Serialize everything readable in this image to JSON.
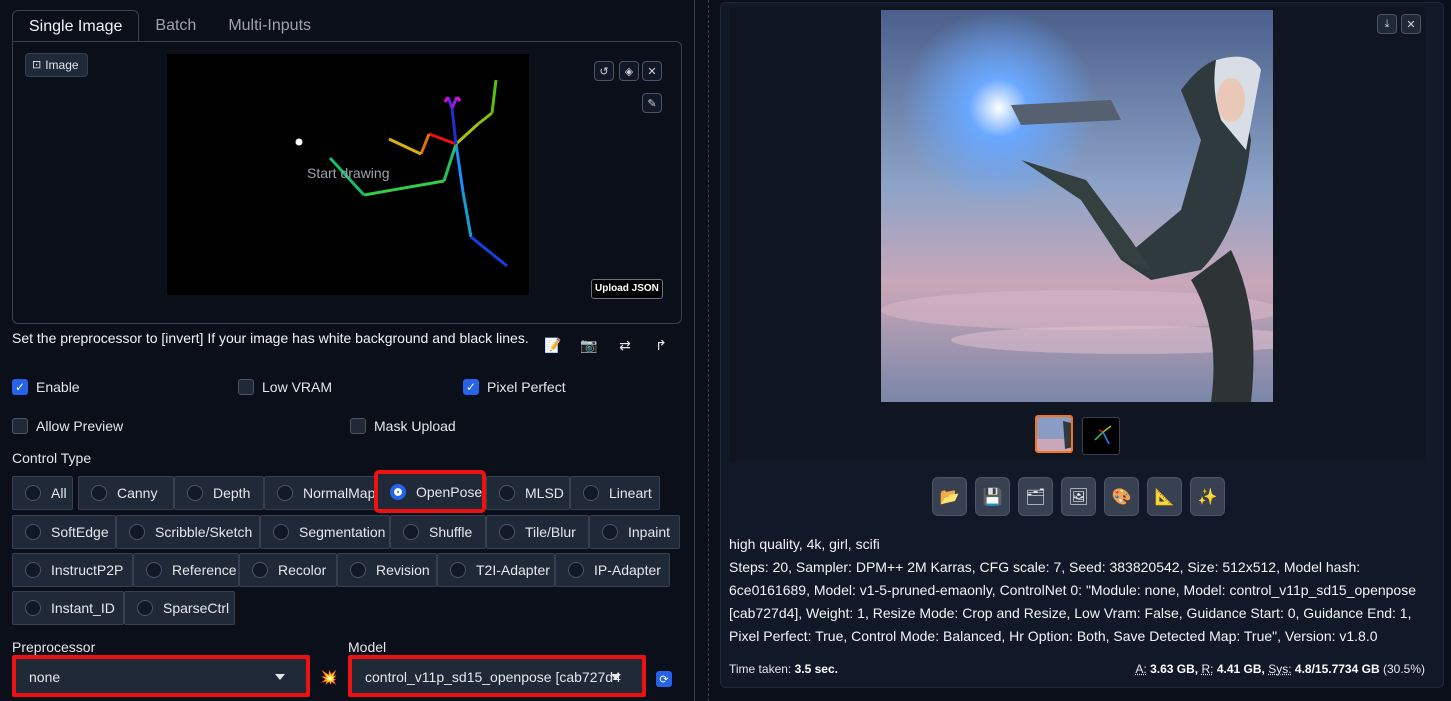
{
  "tabs": [
    "Single Image",
    "Batch",
    "Multi-Inputs"
  ],
  "image_label": "Image",
  "canvas": {
    "placeholder": "Start drawing",
    "upload_json": "Upload JSON"
  },
  "hint": "Set the preprocessor to [invert] If your image has white background and black lines.",
  "tool_icons": [
    "edit-icon",
    "camera-icon",
    "swap-icon",
    "redo-arrow-icon"
  ],
  "checkboxes": {
    "enable": {
      "label": "Enable",
      "checked": true
    },
    "low_vram": {
      "label": "Low VRAM",
      "checked": false
    },
    "pixel_perfect": {
      "label": "Pixel Perfect",
      "checked": true
    },
    "allow_preview": {
      "label": "Allow Preview",
      "checked": false
    },
    "mask_upload": {
      "label": "Mask Upload",
      "checked": false
    }
  },
  "control_type": {
    "label": "Control Type",
    "selected": "OpenPose",
    "options": [
      "All",
      "Canny",
      "Depth",
      "NormalMap",
      "OpenPose",
      "MLSD",
      "Lineart",
      "SoftEdge",
      "Scribble/Sketch",
      "Segmentation",
      "Shuffle",
      "Tile/Blur",
      "Inpaint",
      "InstructP2P",
      "Reference",
      "Recolor",
      "Revision",
      "T2I-Adapter",
      "IP-Adapter",
      "Instant_ID",
      "SparseCtrl"
    ]
  },
  "preprocessor": {
    "label": "Preprocessor",
    "value": "none"
  },
  "model": {
    "label": "Model",
    "value": "control_v11p_sd15_openpose [cab727d4"
  },
  "output": {
    "prompt": "high quality, 4k, girl, scifi",
    "params": "Steps: 20, Sampler: DPM++ 2M Karras, CFG scale: 7, Seed: 383820542, Size: 512x512, Model hash: 6ce0161689, Model: v1-5-pruned-emaonly, ControlNet 0: \"Module: none, Model: control_v11p_sd15_openpose [cab727d4], Weight: 1, Resize Mode: Crop and Resize, Low Vram: False, Guidance Start: 0, Guidance End: 1, Pixel Perfect: True, Control Mode: Balanced, Hr Option: Both, Save Detected Map: True\", Version: v1.8.0",
    "time_label": "Time taken:",
    "time_value": "3.5 sec.",
    "mem_a_label": "A:",
    "mem_a": "3.63 GB,",
    "mem_r_label": "R:",
    "mem_r": "4.41 GB,",
    "mem_sys_label": "Sys:",
    "mem_sys": "4.8/15.7734 GB",
    "mem_pct": "(30.5%)"
  },
  "action_buttons": [
    "folder-icon",
    "save-icon",
    "zip-icon",
    "image-icon",
    "palette-icon",
    "ruler-icon",
    "sparkle-icon"
  ],
  "colors": {
    "accent": "#2563eb",
    "highlight": "#ee1111",
    "panel": "#111827"
  }
}
